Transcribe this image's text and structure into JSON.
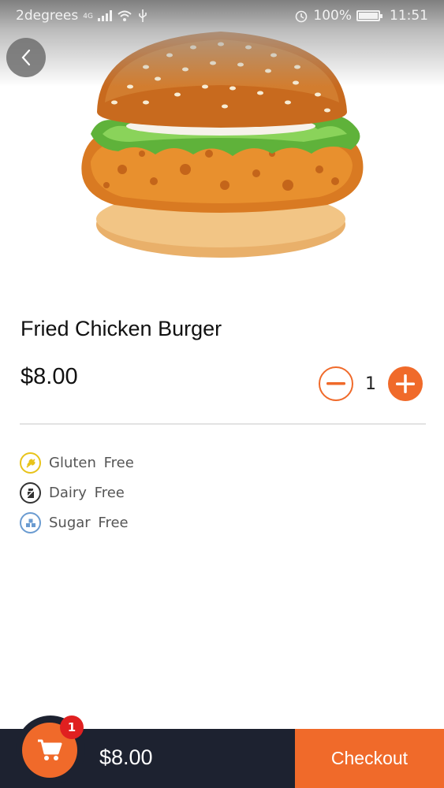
{
  "status_bar": {
    "carrier": "2degrees",
    "network": "4G",
    "battery": "100%",
    "time": "11:51"
  },
  "product": {
    "name": "Fried Chicken Burger",
    "price": "$8.00",
    "quantity": "1"
  },
  "dietary": [
    {
      "label": "Gluten  Free",
      "icon": "wheat-icon",
      "color": "#e8c31a"
    },
    {
      "label": "Dairy  Free",
      "icon": "milk-bottle-icon",
      "color": "#333333"
    },
    {
      "label": "Sugar  Free",
      "icon": "sugar-cubes-icon",
      "color": "#6a9bd1"
    }
  ],
  "cart": {
    "badge_count": "1",
    "total": "$8.00",
    "checkout_label": "Checkout"
  },
  "colors": {
    "accent": "#f06a2a",
    "bottom_bar": "#1d2230",
    "badge": "#e02020"
  }
}
